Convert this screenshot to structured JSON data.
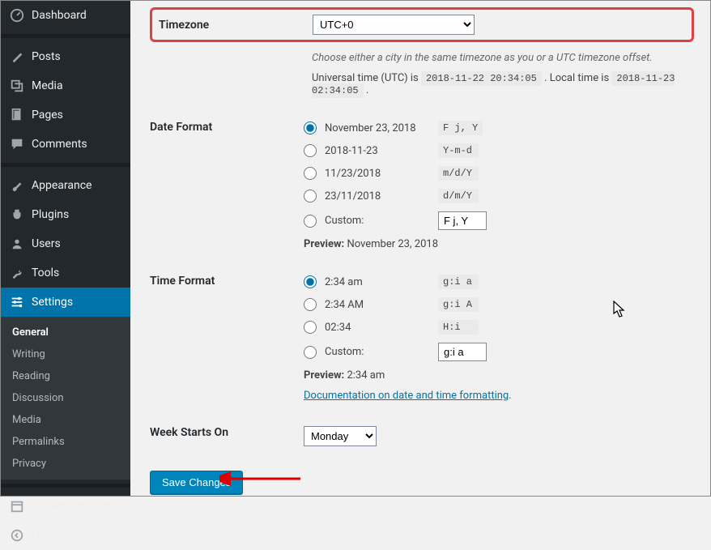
{
  "sidebar": {
    "items": [
      {
        "label": "Dashboard"
      },
      {
        "label": "Posts"
      },
      {
        "label": "Media"
      },
      {
        "label": "Pages"
      },
      {
        "label": "Comments"
      },
      {
        "label": "Appearance"
      },
      {
        "label": "Plugins"
      },
      {
        "label": "Users"
      },
      {
        "label": "Tools"
      },
      {
        "label": "Settings"
      }
    ],
    "sub": [
      "General",
      "Writing",
      "Reading",
      "Discussion",
      "Media",
      "Permalinks",
      "Privacy"
    ],
    "scheduled": "Scheduled Posts",
    "collapse": "Collapse menu"
  },
  "timezone": {
    "label": "Timezone",
    "value": "UTC+0",
    "desc": "Choose either a city in the same timezone as you or a UTC timezone offset.",
    "utc_label": "Universal time (UTC) is ",
    "utc_value": "2018-11-22 20:34:05",
    "local_label": ". Local time is ",
    "local_value": "2018-11-23 02:34:05",
    "period": "."
  },
  "date": {
    "label": "Date Format",
    "opts": [
      {
        "ex": "November 23, 2018",
        "code": "F j, Y",
        "checked": true
      },
      {
        "ex": "2018-11-23",
        "code": "Y-m-d"
      },
      {
        "ex": "11/23/2018",
        "code": "m/d/Y"
      },
      {
        "ex": "23/11/2018",
        "code": "d/m/Y"
      }
    ],
    "custom_label": "Custom:",
    "custom_value": "F j, Y",
    "preview_label": "Preview:",
    "preview_value": "November 23, 2018"
  },
  "time": {
    "label": "Time Format",
    "opts": [
      {
        "ex": "2:34 am",
        "code": "g:i a",
        "checked": true
      },
      {
        "ex": "2:34 AM",
        "code": "g:i A"
      },
      {
        "ex": "02:34",
        "code": "H:i"
      }
    ],
    "custom_label": "Custom:",
    "custom_value": "g:i a",
    "preview_label": "Preview:",
    "preview_value": "2:34 am",
    "doc_link": "Documentation on date and time formatting"
  },
  "week": {
    "label": "Week Starts On",
    "value": "Monday"
  },
  "save": "Save Changes"
}
